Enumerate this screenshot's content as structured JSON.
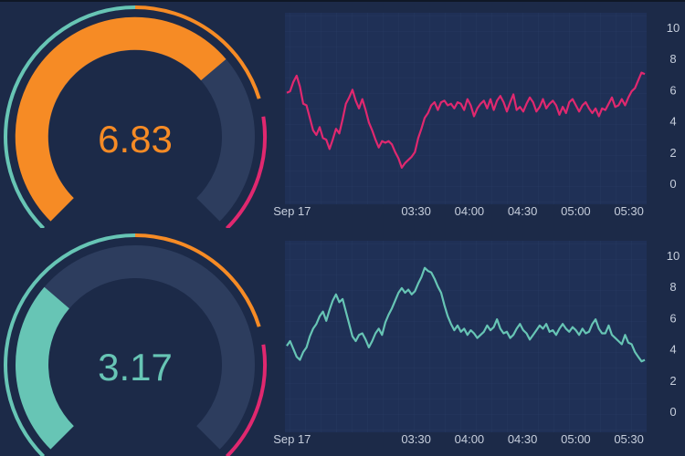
{
  "colors": {
    "background": "#1c2a48",
    "plot_background": "#1f3056",
    "gauge_track": "#2d3d5e",
    "accent_orange": "#f68b25",
    "accent_teal": "#67c5b5",
    "accent_pink": "#e0286f",
    "tick_text": "#c7cfdd"
  },
  "gauges": [
    {
      "value_label": "6.83",
      "value_fraction": 0.683,
      "fill_color": "#f68b25",
      "outer_ring_segments": [
        {
          "from": 0.0,
          "to": 0.5,
          "color": "#67c5b5"
        },
        {
          "from": 0.5,
          "to": 0.77,
          "color": "#f68b25"
        },
        {
          "from": 0.8,
          "to": 1.0,
          "color": "#e0286f"
        }
      ]
    },
    {
      "value_label": "3.17",
      "value_fraction": 0.317,
      "fill_color": "#67c5b5",
      "outer_ring_segments": [
        {
          "from": 0.0,
          "to": 0.5,
          "color": "#67c5b5"
        },
        {
          "from": 0.5,
          "to": 0.77,
          "color": "#f68b25"
        },
        {
          "from": 0.8,
          "to": 1.0,
          "color": "#e0286f"
        }
      ]
    }
  ],
  "chart_data": [
    {
      "type": "line",
      "line_color": "#e0286f",
      "x_tick_labels": [
        "Sep 17",
        "03:30",
        "04:00",
        "04:30",
        "05:00",
        "05:30"
      ],
      "x_tick_minutes": [
        -40,
        30,
        60,
        90,
        120,
        150
      ],
      "xlim_minutes": [
        -44,
        160
      ],
      "y_tick_labels": [
        "0",
        "2",
        "4",
        "6",
        "8",
        "10"
      ],
      "ylim": [
        0,
        10
      ],
      "grid": true,
      "series": [
        {
          "values": [
            5.8,
            5.9,
            6.5,
            6.9,
            6.2,
            5.1,
            5.0,
            4.2,
            3.4,
            3.1,
            3.6,
            2.9,
            2.8,
            2.2,
            2.8,
            3.5,
            3.2,
            4.1,
            5.1,
            5.5,
            6.0,
            5.3,
            4.8,
            5.4,
            4.7,
            3.9,
            3.4,
            2.8,
            2.3,
            2.7,
            2.6,
            2.7,
            2.5,
            2.0,
            1.6,
            1.0,
            1.3,
            1.5,
            1.7,
            2.0,
            2.9,
            3.5,
            4.2,
            4.5,
            5.0,
            5.2,
            4.7,
            5.2,
            5.3,
            5.0,
            5.1,
            4.8,
            5.2,
            5.1,
            4.7,
            5.4,
            5.0,
            4.3,
            4.8,
            5.1,
            5.3,
            4.8,
            5.4,
            4.7,
            5.3,
            5.6,
            5.2,
            4.6,
            5.2,
            5.7,
            4.7,
            4.9,
            4.6,
            5.1,
            5.5,
            5.2,
            4.6,
            4.9,
            5.4,
            4.8,
            5.1,
            5.3,
            5.0,
            4.4,
            4.9,
            4.5,
            5.2,
            5.4,
            5.0,
            4.6,
            5.0,
            5.2,
            4.8,
            4.5,
            4.8,
            4.3,
            4.8,
            4.7,
            5.1,
            5.5,
            4.9,
            5.0,
            5.4,
            5.0,
            5.5,
            5.9,
            6.1,
            6.6,
            7.1,
            7.0
          ]
        }
      ]
    },
    {
      "type": "line",
      "line_color": "#67c5b5",
      "x_tick_labels": [
        "Sep 17",
        "03:30",
        "04:00",
        "04:30",
        "05:00",
        "05:30"
      ],
      "x_tick_minutes": [
        -40,
        30,
        60,
        90,
        120,
        150
      ],
      "xlim_minutes": [
        -44,
        160
      ],
      "y_tick_labels": [
        "0",
        "2",
        "4",
        "6",
        "8",
        "10"
      ],
      "ylim": [
        0,
        10
      ],
      "grid": true,
      "series": [
        {
          "values": [
            4.2,
            4.5,
            4.0,
            3.5,
            3.3,
            3.8,
            4.1,
            4.8,
            5.3,
            5.6,
            6.1,
            6.4,
            5.8,
            6.5,
            7.1,
            7.5,
            7.0,
            7.2,
            6.4,
            5.6,
            4.8,
            4.5,
            4.9,
            5.0,
            4.6,
            4.1,
            4.5,
            5.0,
            5.3,
            4.9,
            5.7,
            6.2,
            6.6,
            7.1,
            7.6,
            7.9,
            7.6,
            7.8,
            7.5,
            7.7,
            8.2,
            8.6,
            9.2,
            9.0,
            8.9,
            8.5,
            8.0,
            7.6,
            6.8,
            6.1,
            5.6,
            5.2,
            5.5,
            5.1,
            5.3,
            4.9,
            5.2,
            5.0,
            4.7,
            4.9,
            5.1,
            5.5,
            5.2,
            5.4,
            5.9,
            5.3,
            5.0,
            5.1,
            4.7,
            4.9,
            5.3,
            5.6,
            5.2,
            5.0,
            4.6,
            4.9,
            5.2,
            5.5,
            5.3,
            5.6,
            5.1,
            5.2,
            4.9,
            5.3,
            5.6,
            5.3,
            5.1,
            5.4,
            5.2,
            4.9,
            5.3,
            5.0,
            5.1,
            5.6,
            5.9,
            5.3,
            5.0,
            5.0,
            5.5,
            4.9,
            4.7,
            4.5,
            4.3,
            4.9,
            4.4,
            4.3,
            3.8,
            3.5,
            3.2,
            3.3
          ]
        }
      ]
    }
  ]
}
